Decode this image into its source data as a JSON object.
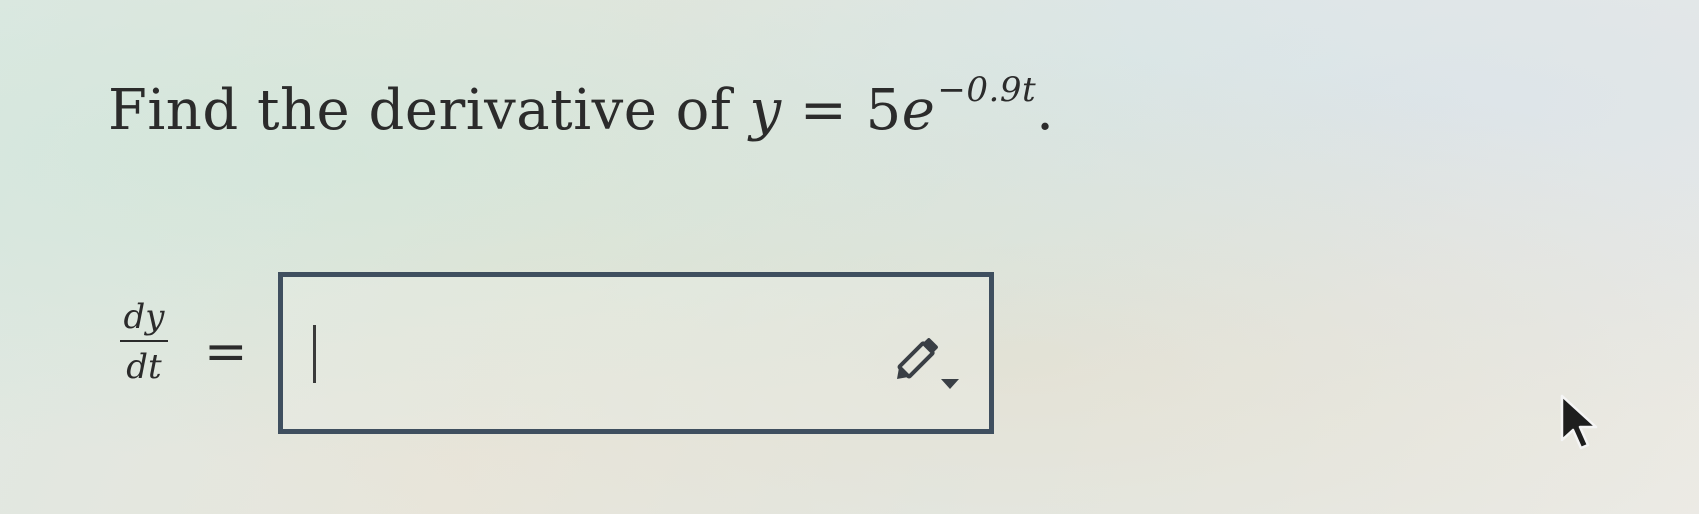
{
  "question": {
    "prefix": "Find the derivative of",
    "lhs": "y",
    "equals": "=",
    "coefficient": "5",
    "base": "e",
    "exponent": "−0.9t",
    "suffix": "."
  },
  "answer": {
    "fraction_numerator": "dy",
    "fraction_denominator": "dt",
    "equals": "=",
    "input_value": ""
  },
  "icons": {
    "editor": "pencil-icon",
    "editor_dropdown": "dropdown-caret-icon",
    "pointer": "mouse-pointer-icon"
  },
  "colors": {
    "box_border": "#3f4f5f",
    "text": "#2b2b2b"
  }
}
